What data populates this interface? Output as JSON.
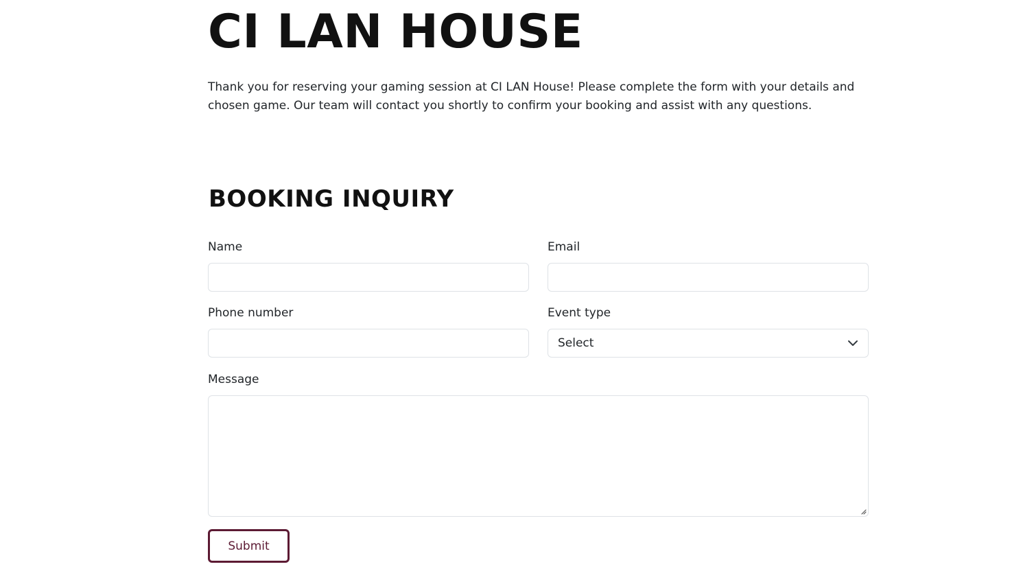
{
  "site_title": "CI LAN HOUSE",
  "intro_text": "Thank you for reserving your gaming session at CI LAN House! Please complete the form with your details and chosen game. Our team will contact you shortly to confirm your booking and assist with any questions.",
  "form": {
    "title": "BOOKING INQUIRY",
    "name_label": "Name",
    "name_value": "",
    "email_label": "Email",
    "email_value": "",
    "phone_label": "Phone number",
    "phone_value": "",
    "event_type_label": "Event type",
    "event_type_selected": "Select",
    "message_label": "Message",
    "message_value": "",
    "submit_label": "Submit"
  },
  "colors": {
    "accent": "#5c1a33",
    "input_border": "#dee2e6",
    "text": "#212529"
  },
  "icons": {
    "select_chevron": "chevron-down-icon",
    "textarea_resize": "resize-handle-icon"
  }
}
